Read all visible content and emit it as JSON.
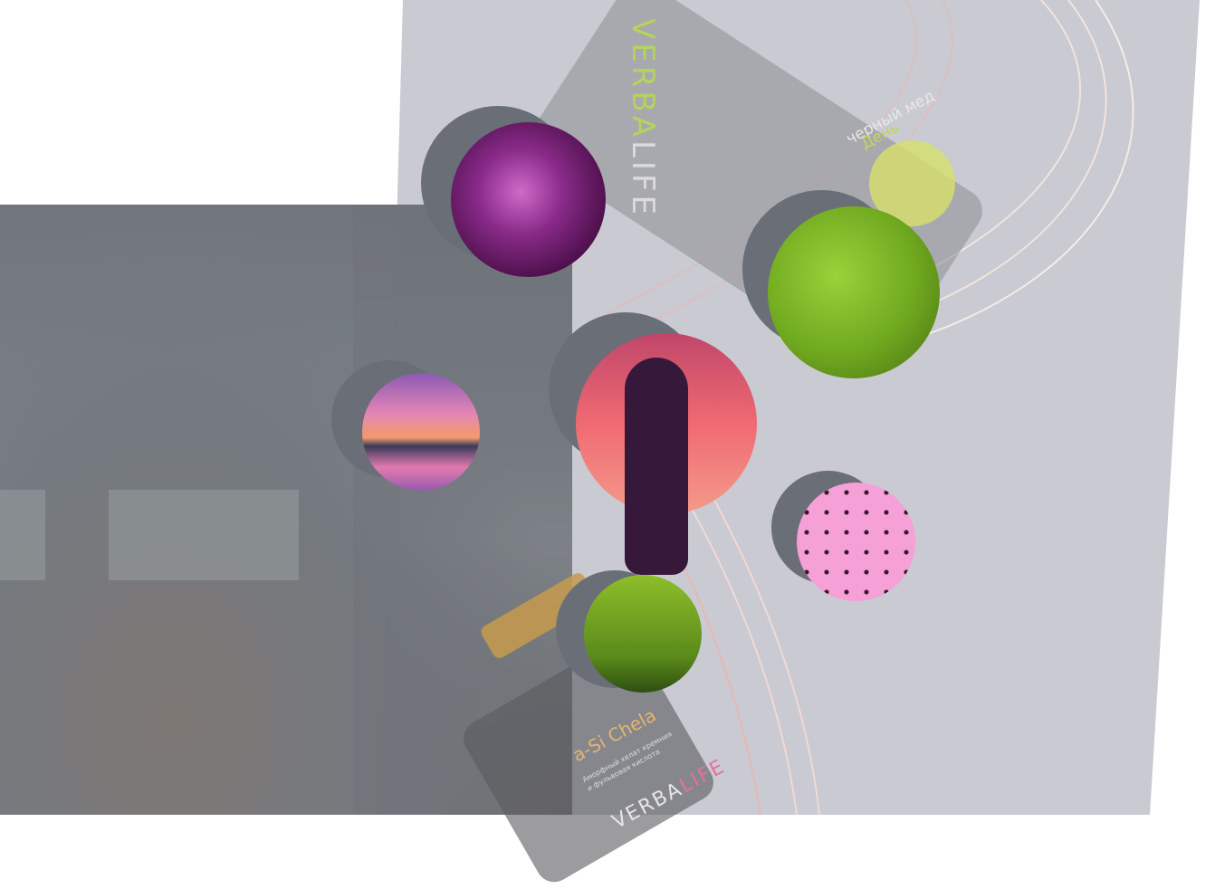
{
  "product_pouch": {
    "brand_part1": "VERBA",
    "brand_part2": "LIFE",
    "name": "черный мед",
    "variant": "День"
  },
  "product_bottle": {
    "name": "a-Si Chela",
    "description_line1": "Аморфный хелат кремния",
    "description_line2": "и фульвовая кислота",
    "brand_part1": "VERBA",
    "brand_part2": "LIFE"
  },
  "colors": {
    "panel": "#c9cad2",
    "overlay": "#5f646c",
    "accent_green": "#b4d45c",
    "accent_pink": "#e86f9c"
  }
}
